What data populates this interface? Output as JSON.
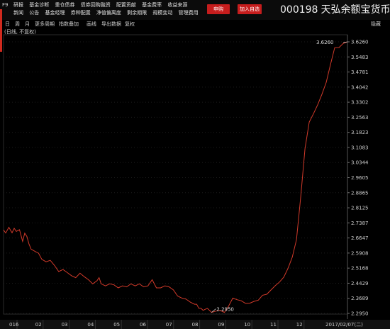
{
  "header": {
    "f9": "F9",
    "menu_row1": [
      "研报",
      "基金诊断",
      "重仓债券",
      "债券回购融资",
      "配置贡献",
      "基金费率",
      "收益来源"
    ],
    "menu_row2": [
      "新闻",
      "公告",
      "基金经理",
      "券种配置",
      "净值偏离度",
      "剩余期限",
      "规模变动",
      "管理费用"
    ],
    "subscribe_label": "申购",
    "add_watchlist_label": "加入自选",
    "fund_code": "000198",
    "fund_name": "天弘余额宝货币"
  },
  "toolbar": {
    "items": [
      "日",
      "周",
      "月",
      "更多周期",
      "指数叠加",
      "画线",
      "导出数据",
      "复权"
    ],
    "hide_label": "隐藏",
    "sub_label": "(日线, 不复权)"
  },
  "colors": {
    "line": "#d23a2a",
    "accent_button": "#c61d1d",
    "background": "#000000",
    "grid": "#2e2e2e"
  },
  "chart_data": {
    "type": "line",
    "y_ticks": [
      "3.6260",
      "3.5483",
      "3.4781",
      "3.4042",
      "3.3302",
      "3.2563",
      "3.1823",
      "3.1083",
      "3.0344",
      "2.9605",
      "2.8865",
      "2.8125",
      "2.7387",
      "2.6647",
      "2.5908",
      "2.5168",
      "2.4429",
      "2.3689",
      "2.2950"
    ],
    "x_ticks": [
      "016",
      "02",
      "03",
      "04",
      "05",
      "06",
      "07",
      "08",
      "09",
      "10",
      "11",
      "12",
      "2017/02/07(二)"
    ],
    "ylim": [
      2.295,
      3.626
    ],
    "annotations": {
      "max_label": "3.6260",
      "min_label": "2.2950"
    },
    "x": [
      0.0,
      0.1,
      0.25,
      0.4,
      0.5,
      0.6,
      0.75,
      0.9,
      1.0,
      1.1,
      1.2,
      1.3,
      1.5,
      1.65,
      1.8,
      2.0,
      2.2,
      2.4,
      2.6,
      2.8,
      3.0,
      3.2,
      3.4,
      3.6,
      3.8,
      4.0,
      4.2,
      4.4,
      4.5,
      4.6,
      4.8,
      5.0,
      5.2,
      5.4,
      5.6,
      5.8,
      6.0,
      6.2,
      6.4,
      6.6,
      6.8,
      7.0,
      7.2,
      7.4,
      7.6,
      7.8,
      8.0,
      8.2,
      8.4,
      8.6,
      8.8,
      9.0,
      9.1,
      9.2,
      9.3,
      9.4,
      9.6,
      9.8,
      10.0,
      10.2,
      10.4,
      10.6,
      10.8,
      11.0,
      11.2,
      11.4,
      11.6,
      11.8,
      12.0,
      12.2,
      12.4,
      12.6,
      12.8,
      13.0,
      13.2,
      13.4,
      13.6,
      13.8,
      14.0,
      14.2,
      14.4,
      14.6,
      14.8,
      15.0,
      15.2,
      15.4,
      15.6,
      15.8,
      16.0,
      16.2
    ],
    "y": [
      2.704,
      2.689,
      2.717,
      2.69,
      2.712,
      2.697,
      2.705,
      2.648,
      2.688,
      2.672,
      2.635,
      2.61,
      2.598,
      2.59,
      2.56,
      2.548,
      2.555,
      2.53,
      2.5,
      2.51,
      2.495,
      2.48,
      2.47,
      2.492,
      2.475,
      2.46,
      2.44,
      2.455,
      2.47,
      2.44,
      2.43,
      2.44,
      2.435,
      2.42,
      2.43,
      2.425,
      2.44,
      2.43,
      2.44,
      2.425,
      2.43,
      2.46,
      2.42,
      2.42,
      2.43,
      2.425,
      2.41,
      2.38,
      2.37,
      2.365,
      2.35,
      2.34,
      2.34,
      2.32,
      2.32,
      2.31,
      2.32,
      2.3,
      2.306,
      2.31,
      2.3,
      2.33,
      2.37,
      2.362,
      2.357,
      2.344,
      2.345,
      2.354,
      2.36,
      2.384,
      2.389,
      2.41,
      2.431,
      2.449,
      2.473,
      2.516,
      2.571,
      2.656,
      2.866,
      3.102,
      3.233,
      3.274,
      3.318,
      3.37,
      3.428,
      3.514,
      3.597,
      3.598,
      3.618,
      3.626
    ],
    "x_range": [
      0,
      16.2
    ]
  }
}
